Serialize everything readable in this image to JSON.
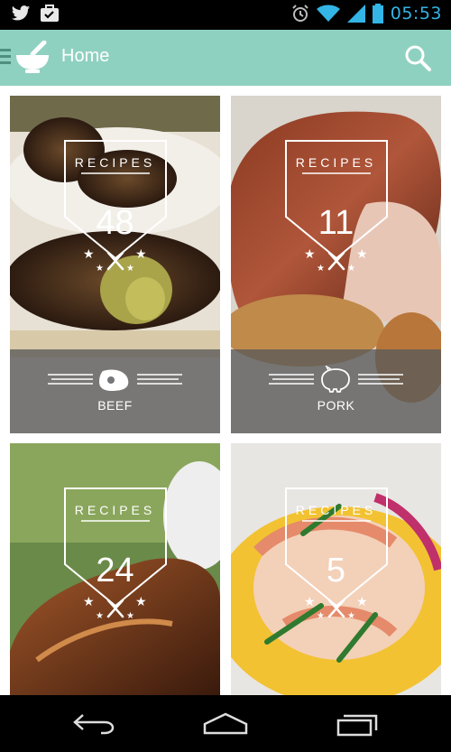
{
  "status_bar": {
    "left_icons": [
      "twitter-icon",
      "briefcase-check-icon"
    ],
    "right_icons": [
      "alarm-icon",
      "wifi-icon",
      "signal-icon",
      "battery-icon"
    ],
    "time": "05:53",
    "time_color": "#33b5e5"
  },
  "app_bar": {
    "title": "Home",
    "background": "#8fd1c0",
    "icons": [
      "menu-icon",
      "mortar-pestle-icon",
      "search-icon"
    ]
  },
  "cards": [
    {
      "badge_title": "RECIPES",
      "count": "48",
      "category": "BEEF",
      "category_icon": "steak-icon"
    },
    {
      "badge_title": "RECIPES",
      "count": "11",
      "category": "PORK",
      "category_icon": "pig-icon"
    },
    {
      "badge_title": "RECIPES",
      "count": "24",
      "category": "",
      "category_icon": ""
    },
    {
      "badge_title": "RECIPES",
      "count": "5",
      "category": "",
      "category_icon": ""
    }
  ],
  "nav_bar": {
    "buttons": [
      "back-icon",
      "home-icon",
      "recents-icon"
    ]
  }
}
